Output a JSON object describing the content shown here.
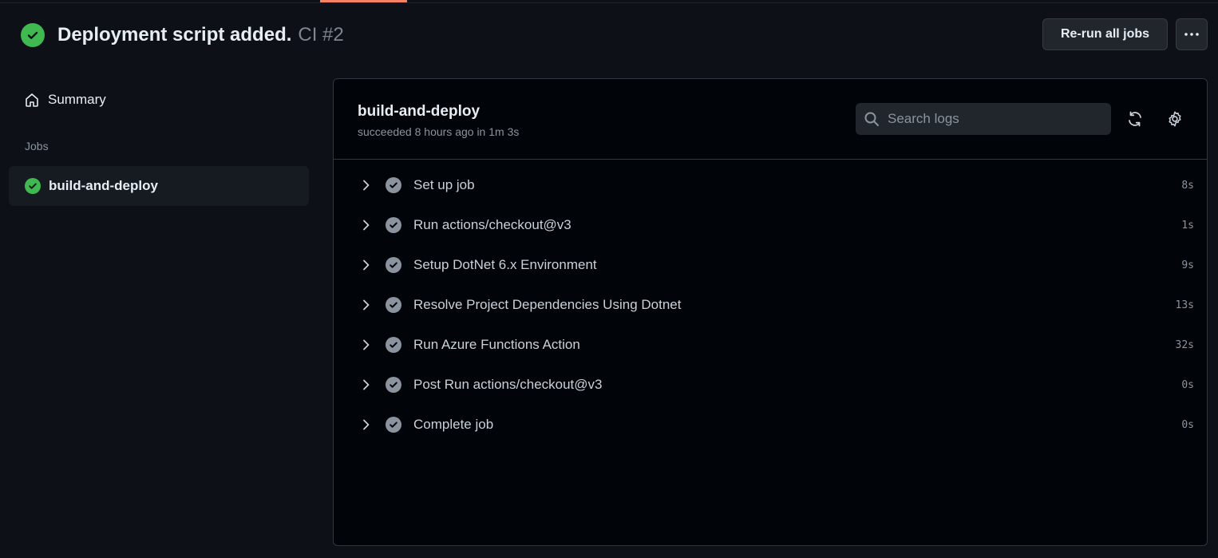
{
  "header": {
    "title": "Deployment script added.",
    "run_id": "CI #2",
    "rerun_label": "Re-run all jobs"
  },
  "sidebar": {
    "summary_label": "Summary",
    "jobs_heading": "Jobs",
    "jobs": [
      {
        "label": "build-and-deploy",
        "status": "success"
      }
    ]
  },
  "job": {
    "title": "build-and-deploy",
    "meta": "succeeded 8 hours ago in 1m 3s",
    "search_placeholder": "Search logs",
    "steps": [
      {
        "label": "Set up job",
        "time": "8s"
      },
      {
        "label": "Run actions/checkout@v3",
        "time": "1s"
      },
      {
        "label": "Setup DotNet 6.x Environment",
        "time": "9s"
      },
      {
        "label": "Resolve Project Dependencies Using Dotnet",
        "time": "13s"
      },
      {
        "label": "Run Azure Functions Action",
        "time": "32s"
      },
      {
        "label": "Post Run actions/checkout@v3",
        "time": "0s"
      },
      {
        "label": "Complete job",
        "time": "0s"
      }
    ]
  },
  "icons": {
    "status": "check-circle-icon",
    "summary": "home-icon",
    "search": "search-icon",
    "refresh": "refresh-icon",
    "settings": "gear-icon",
    "more": "kebab-horizontal-icon",
    "expand": "chevron-right-icon"
  },
  "colors": {
    "background": "#0d1117",
    "panel": "#010409",
    "success": "#3fb950",
    "step_done": "#8b949e",
    "accent_tab": "#f78166"
  }
}
